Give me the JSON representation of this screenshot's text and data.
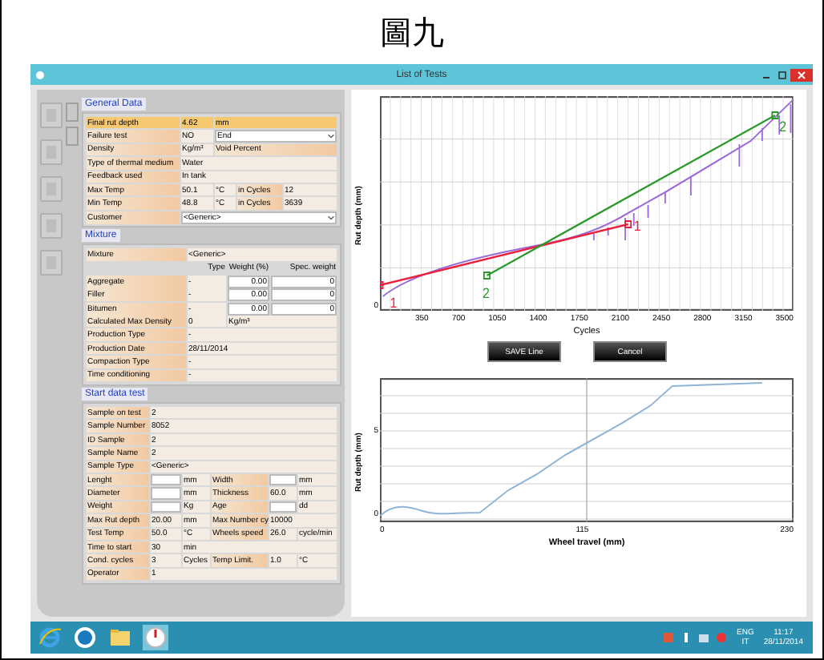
{
  "title": "圖九",
  "window": {
    "title": "List of Tests"
  },
  "form": {
    "sections": [
      {
        "title": "General Data",
        "rows": [
          {
            "kind": "result",
            "cells": [
              {
                "kind": "label",
                "text": "Final rut depth"
              },
              {
                "kind": "value",
                "text": "4.62"
              },
              {
                "kind": "unit",
                "text": "mm"
              }
            ]
          },
          {
            "kind": "field",
            "cells": [
              {
                "kind": "label",
                "text": "Failure test"
              },
              {
                "kind": "value",
                "text": "NO"
              },
              {
                "kind": "select",
                "text": "End"
              }
            ]
          },
          {
            "kind": "field",
            "cells": [
              {
                "kind": "label",
                "text": "Density"
              },
              {
                "kind": "unit",
                "text": "Kg/m³"
              },
              {
                "kind": "label",
                "text": "Void Percent"
              }
            ]
          },
          {
            "kind": "field",
            "cells": [
              {
                "kind": "label",
                "text": "Type of thermal medium"
              },
              {
                "kind": "value",
                "text": "Water"
              }
            ]
          },
          {
            "kind": "field",
            "cells": [
              {
                "kind": "label",
                "text": "Feedback used"
              },
              {
                "kind": "value",
                "text": "In tank"
              }
            ]
          },
          {
            "kind": "field",
            "cells": [
              {
                "kind": "label",
                "text": "Max Temp"
              },
              {
                "kind": "value",
                "text": "50.1"
              },
              {
                "kind": "unit",
                "text": "°C"
              },
              {
                "kind": "label",
                "text": "in Cycles"
              },
              {
                "kind": "value",
                "text": "12"
              }
            ]
          },
          {
            "kind": "field",
            "cells": [
              {
                "kind": "label",
                "text": "Min Temp"
              },
              {
                "kind": "value",
                "text": "48.8"
              },
              {
                "kind": "unit",
                "text": "°C"
              },
              {
                "kind": "label",
                "text": "in Cycles"
              },
              {
                "kind": "value",
                "text": "3639"
              }
            ]
          },
          {
            "kind": "field",
            "cells": [
              {
                "kind": "label",
                "text": "Customer"
              },
              {
                "kind": "select",
                "text": "<Generic>"
              }
            ]
          }
        ]
      },
      {
        "title": "Mixture",
        "rows": [
          {
            "kind": "field",
            "cells": [
              {
                "kind": "label",
                "text": "Mixture"
              },
              {
                "kind": "value",
                "text": "<Generic>"
              }
            ]
          },
          {
            "kind": "header",
            "cells": [
              {
                "kind": "blank"
              },
              {
                "kind": "value",
                "text": "Type"
              },
              {
                "kind": "value",
                "text": "Weight (%)"
              },
              {
                "kind": "value",
                "text": "Spec. weight"
              }
            ]
          },
          {
            "kind": "field",
            "cells": [
              {
                "kind": "label",
                "text": "Aggregate"
              },
              {
                "kind": "value",
                "text": "-"
              },
              {
                "kind": "input",
                "text": "0.00"
              },
              {
                "kind": "input",
                "text": "0"
              }
            ]
          },
          {
            "kind": "field",
            "cells": [
              {
                "kind": "label",
                "text": "Filler"
              },
              {
                "kind": "value",
                "text": "-"
              },
              {
                "kind": "input",
                "text": "0.00"
              },
              {
                "kind": "input",
                "text": "0"
              }
            ]
          },
          {
            "kind": "field",
            "cells": [
              {
                "kind": "label",
                "text": "Bitumen"
              },
              {
                "kind": "value",
                "text": "-"
              },
              {
                "kind": "input",
                "text": "0.00"
              },
              {
                "kind": "input",
                "text": "0"
              }
            ]
          },
          {
            "kind": "field",
            "cells": [
              {
                "kind": "label",
                "text": "Calculated Max Density"
              },
              {
                "kind": "value",
                "text": "0"
              },
              {
                "kind": "unit",
                "text": "Kg/m³"
              }
            ]
          },
          {
            "kind": "field",
            "cells": [
              {
                "kind": "label",
                "text": "Production Type"
              },
              {
                "kind": "value",
                "text": "-"
              }
            ]
          },
          {
            "kind": "field",
            "cells": [
              {
                "kind": "label",
                "text": "Production Date"
              },
              {
                "kind": "value",
                "text": "28/11/2014"
              }
            ]
          },
          {
            "kind": "field",
            "cells": [
              {
                "kind": "label",
                "text": "Compaction Type"
              },
              {
                "kind": "value",
                "text": "-"
              }
            ]
          },
          {
            "kind": "field",
            "cells": [
              {
                "kind": "label",
                "text": "Time conditioning"
              },
              {
                "kind": "value",
                "text": "-"
              }
            ]
          }
        ]
      },
      {
        "title": "Start data test",
        "rows": [
          {
            "kind": "field",
            "cells": [
              {
                "kind": "label",
                "text": "Sample on test"
              },
              {
                "kind": "value",
                "text": "2"
              }
            ]
          },
          {
            "kind": "field",
            "cells": [
              {
                "kind": "label",
                "text": "Sample Number"
              },
              {
                "kind": "value",
                "text": "8052"
              }
            ]
          },
          {
            "kind": "field",
            "cells": [
              {
                "kind": "label",
                "text": "ID Sample"
              },
              {
                "kind": "value",
                "text": "2"
              }
            ]
          },
          {
            "kind": "field",
            "cells": [
              {
                "kind": "label",
                "text": "Sample Name"
              },
              {
                "kind": "value",
                "text": "2"
              }
            ]
          },
          {
            "kind": "field",
            "cells": [
              {
                "kind": "label",
                "text": "Sample Type"
              },
              {
                "kind": "value",
                "text": "<Generic>"
              }
            ]
          },
          {
            "kind": "field",
            "cells": [
              {
                "kind": "label",
                "text": "Lenght"
              },
              {
                "kind": "input"
              },
              {
                "kind": "unit",
                "text": "mm"
              },
              {
                "kind": "label",
                "text": "Width"
              },
              {
                "kind": "input"
              },
              {
                "kind": "unit",
                "text": "mm"
              }
            ]
          },
          {
            "kind": "field",
            "cells": [
              {
                "kind": "label",
                "text": "Diameter"
              },
              {
                "kind": "input"
              },
              {
                "kind": "unit",
                "text": "mm"
              },
              {
                "kind": "label",
                "text": "Thickness"
              },
              {
                "kind": "value",
                "text": "60.0"
              },
              {
                "kind": "unit",
                "text": "mm"
              }
            ]
          },
          {
            "kind": "field",
            "cells": [
              {
                "kind": "label",
                "text": "Weight"
              },
              {
                "kind": "input"
              },
              {
                "kind": "unit",
                "text": "Kg"
              },
              {
                "kind": "label",
                "text": "Age"
              },
              {
                "kind": "input"
              },
              {
                "kind": "unit",
                "text": "dd"
              }
            ]
          },
          {
            "kind": "field",
            "cells": [
              {
                "kind": "label",
                "text": "Max Rut depth"
              },
              {
                "kind": "value",
                "text": "20.00"
              },
              {
                "kind": "unit",
                "text": "mm"
              },
              {
                "kind": "label",
                "text": "Max Number cy"
              },
              {
                "kind": "value",
                "text": "10000"
              }
            ]
          },
          {
            "kind": "field",
            "cells": [
              {
                "kind": "label",
                "text": "Test Temp"
              },
              {
                "kind": "value",
                "text": "50.0"
              },
              {
                "kind": "unit",
                "text": "°C"
              },
              {
                "kind": "label",
                "text": "Wheels speed"
              },
              {
                "kind": "value",
                "text": "26.0"
              },
              {
                "kind": "unit",
                "text": "cycle/min"
              }
            ]
          },
          {
            "kind": "field",
            "cells": [
              {
                "kind": "label",
                "text": "Time to start"
              },
              {
                "kind": "value",
                "text": "30"
              },
              {
                "kind": "unit",
                "text": "min"
              }
            ]
          },
          {
            "kind": "field",
            "cells": [
              {
                "kind": "label",
                "text": "Cond. cycles"
              },
              {
                "kind": "value",
                "text": "3"
              },
              {
                "kind": "unit",
                "text": "Cycles"
              },
              {
                "kind": "label",
                "text": "Temp Limit."
              },
              {
                "kind": "value",
                "text": "1.0"
              },
              {
                "kind": "unit",
                "text": "°C"
              }
            ]
          },
          {
            "kind": "field",
            "cells": [
              {
                "kind": "label",
                "text": "Operator"
              },
              {
                "kind": "value",
                "text": "1"
              }
            ]
          }
        ]
      }
    ]
  },
  "charts": [
    {
      "ylabel": "Rut depth (mm)",
      "xlabel": "Cycles",
      "xticks": [
        "350",
        "700",
        "1050",
        "1400",
        "1750",
        "2100",
        "2450",
        "2800",
        "3150",
        "3500"
      ],
      "yticks": [
        "0"
      ],
      "line_labels": [
        {
          "text": "1",
          "color": "#e8203c"
        },
        {
          "text": "1",
          "color": "#e8203c"
        },
        {
          "text": "2",
          "color": "#2a9a2a"
        },
        {
          "text": "2",
          "color": "#2a9a2a"
        }
      ]
    },
    {
      "ylabel": "Rut depth (mm)",
      "xlabel": "Wheel travel (mm)",
      "xticks": [
        "0",
        "115",
        "230"
      ],
      "yticks": [
        "5",
        "0"
      ]
    }
  ],
  "buttons": [
    "SAVE Line",
    "Cancel"
  ],
  "tray": {
    "language": "ENG",
    "layout": "IT",
    "time": "11:17",
    "date": "28/11/2014"
  }
}
